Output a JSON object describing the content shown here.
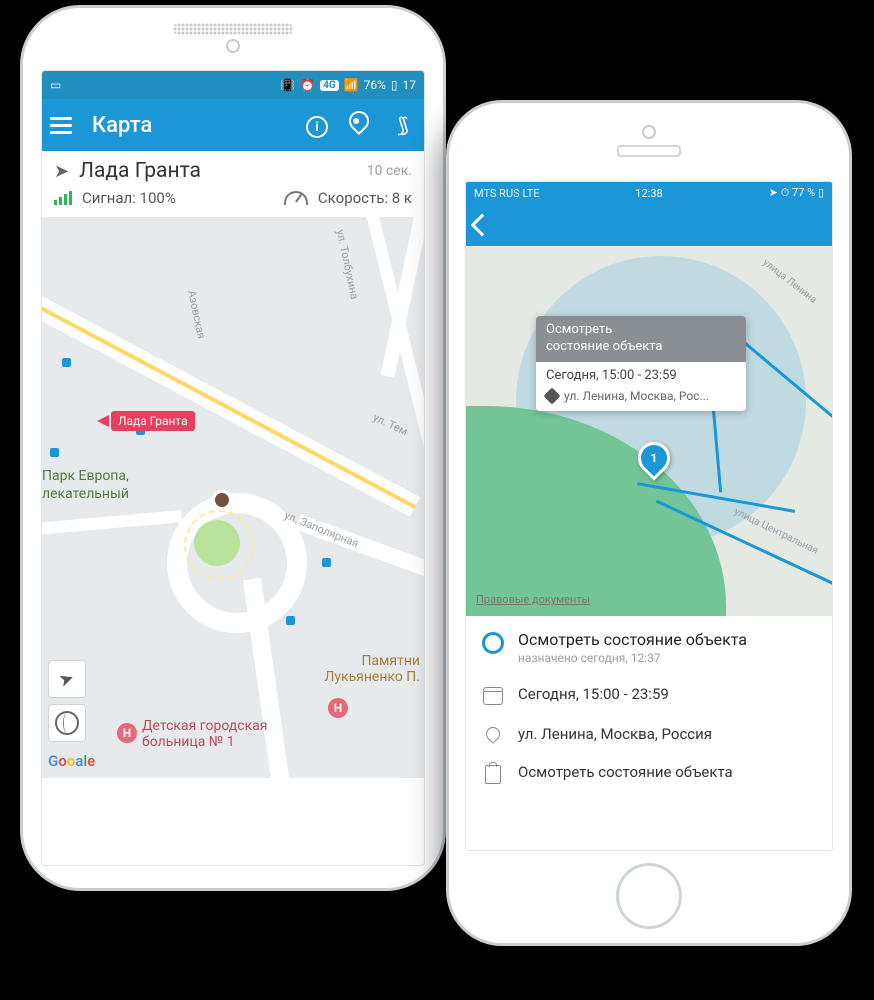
{
  "phone1": {
    "status": {
      "battery": "76%",
      "time": "17",
      "net_label": "4G"
    },
    "appbar": {
      "title": "Карта"
    },
    "info": {
      "vehicle_name": "Лада Гранта",
      "updated_ago": "10 сек.",
      "signal_label": "Сигнал: 100%",
      "speed_label": "Скорость: 8 к"
    },
    "map": {
      "tracker_label": "Лада Гранта",
      "poi_park_line1": "Парк Европа,",
      "poi_park_line2": "лекательный",
      "poi_monument_line1": "Памятни",
      "poi_monument_line2": "Лукьяненко П.",
      "poi_hospital_line1": "Детская городская",
      "poi_hospital_line2": "больница № 1",
      "street_tolbukhina": "ул. Толбухина",
      "street_azovskaya": "Азовская",
      "street_tem": "ул. Тем",
      "street_zapolyarnaya": "ул. Заполярная",
      "attribution": "Gooale"
    }
  },
  "phone2": {
    "status": {
      "carrier": "MTS RUS  LTE",
      "time": "12:38",
      "battery": "77 %"
    },
    "marker_number": "1",
    "tooltip": {
      "title_l1": "Осмотреть",
      "title_l2": "состояние объекта",
      "time": "Сегодня, 15:00 - 23:59",
      "address": "ул. Ленина, Москва, Рос..."
    },
    "map": {
      "street_lenina": "улица Ленина",
      "street_central": "улица Центральная",
      "legal": "Правовые документы"
    },
    "details": {
      "task_title": "Осмотреть состояние объекта",
      "assigned": "назначено сегодня, 12:37",
      "time": "Сегодня, 15:00 - 23:59",
      "address": "ул. Ленина, Москва, Россия",
      "description": "Осмотреть состояние объекта"
    }
  }
}
